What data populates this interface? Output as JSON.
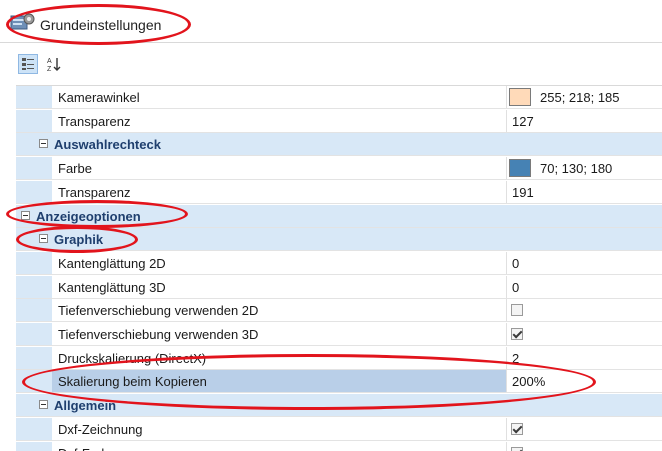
{
  "window": {
    "title": "Grundeinstellungen",
    "icon": "settings-gear-icon"
  },
  "toolbar": {
    "buttons": [
      {
        "name": "categorized-view",
        "icon": "categorized-icon",
        "active": true
      },
      {
        "name": "alphabetical-sort",
        "icon": "sort-az-icon",
        "active": false
      }
    ]
  },
  "grid": {
    "rows": [
      {
        "type": "prop",
        "label": "Kamerawinkel",
        "value": "255; 218; 185",
        "kind": "color",
        "color": "#ffdab9"
      },
      {
        "type": "prop",
        "label": "Transparenz",
        "value": "127",
        "kind": "text"
      },
      {
        "type": "cat",
        "level": 1,
        "label": "Auswahlrechteck"
      },
      {
        "type": "prop",
        "label": "Farbe",
        "value": "70; 130; 180",
        "kind": "color",
        "color": "#4682b4"
      },
      {
        "type": "prop",
        "label": "Transparenz",
        "value": "191",
        "kind": "text"
      },
      {
        "type": "cat",
        "level": 0,
        "label": "Anzeigeoptionen"
      },
      {
        "type": "cat",
        "level": 1,
        "label": "Graphik"
      },
      {
        "type": "prop",
        "label": "Kantenglättung 2D",
        "value": "0",
        "kind": "text"
      },
      {
        "type": "prop",
        "label": "Kantenglättung 3D",
        "value": "0",
        "kind": "text"
      },
      {
        "type": "prop",
        "label": "Tiefenverschiebung verwenden 2D",
        "value": "",
        "kind": "checkbox",
        "checked": false
      },
      {
        "type": "prop",
        "label": "Tiefenverschiebung verwenden 3D",
        "value": "",
        "kind": "checkbox",
        "checked": true
      },
      {
        "type": "prop",
        "label": "Druckskalierung (DirectX)",
        "value": "2",
        "kind": "text"
      },
      {
        "type": "prop",
        "label": "Skalierung beim Kopieren",
        "value": "200%",
        "kind": "text",
        "selected": true
      },
      {
        "type": "cat",
        "level": 1,
        "label": "Allgemein"
      },
      {
        "type": "prop",
        "label": "Dxf-Zeichnung",
        "value": "",
        "kind": "checkbox",
        "checked": true
      },
      {
        "type": "prop",
        "label": "Dxf-Farbe",
        "value": "",
        "kind": "checkbox",
        "checked": true
      }
    ]
  },
  "colors": {
    "annotation": "#e2141c",
    "category_bg": "#d8e8f7",
    "selected_bg": "#b9cfe8",
    "category_text": "#1f3f6e"
  }
}
